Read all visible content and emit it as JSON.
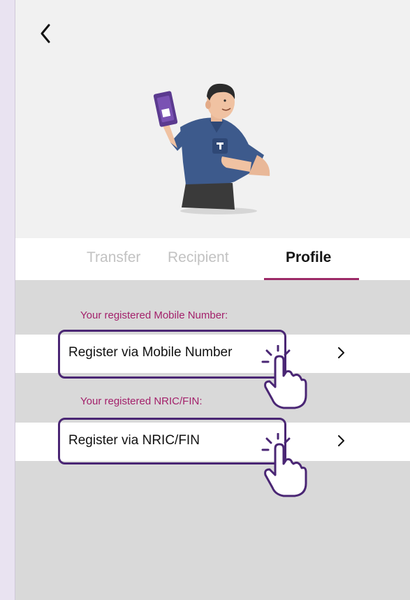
{
  "header": {
    "back_icon": "chevron-left-icon",
    "illustration": "man-holding-scan-pay-phone"
  },
  "tabs": [
    {
      "label": "Transfer",
      "active": false
    },
    {
      "label": "Recipient",
      "active": false
    },
    {
      "label": "Profile",
      "active": true
    }
  ],
  "sections": [
    {
      "title": "Your registered Mobile Number:",
      "action_label": "Register via Mobile Number",
      "action_icon": "chevron-right-icon"
    },
    {
      "title": "Your registered NRIC/FIN:",
      "action_label": "Register via NRIC/FIN",
      "action_icon": "chevron-right-icon"
    }
  ],
  "annotations": {
    "pointer_icon": "tap-hand-icon",
    "highlight_color": "#4a2674"
  },
  "colors": {
    "accent": "#a3216b",
    "underline": "#9c2a67",
    "hero_bg": "#f1f1f1",
    "content_bg": "#d9d9d9"
  }
}
